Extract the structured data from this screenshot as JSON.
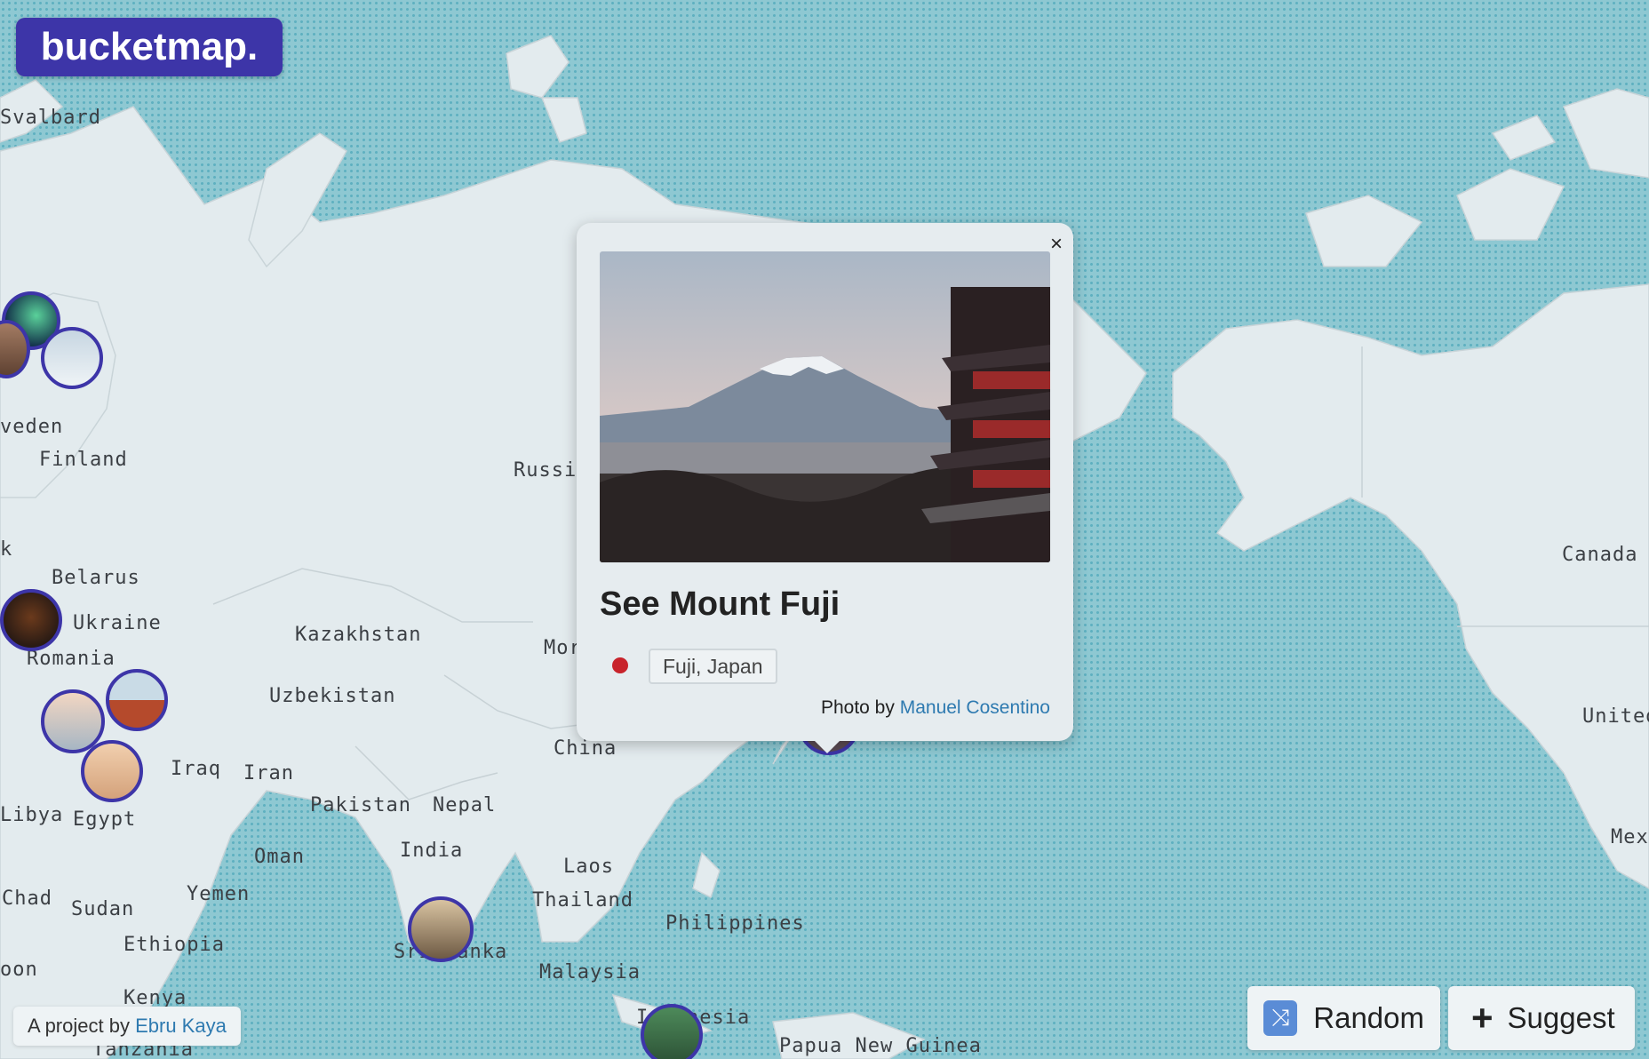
{
  "app": {
    "logo": "bucketmap."
  },
  "map": {
    "countries": [
      {
        "name": "Svalbard"
      },
      {
        "name": "veden"
      },
      {
        "name": "Finland"
      },
      {
        "name": "Russia"
      },
      {
        "name": "Belarus"
      },
      {
        "name": "Ukraine"
      },
      {
        "name": "Romania"
      },
      {
        "name": "Kazakhstan"
      },
      {
        "name": "Uzbekistan"
      },
      {
        "name": "Mor"
      },
      {
        "name": "Iraq"
      },
      {
        "name": "Iran"
      },
      {
        "name": "Libya"
      },
      {
        "name": "Egypt"
      },
      {
        "name": "Pakistan"
      },
      {
        "name": "Nepal"
      },
      {
        "name": "China"
      },
      {
        "name": "India"
      },
      {
        "name": "Oman"
      },
      {
        "name": "Chad"
      },
      {
        "name": "Sudan"
      },
      {
        "name": "Yemen"
      },
      {
        "name": "Laos"
      },
      {
        "name": "Thailand"
      },
      {
        "name": "Philippines"
      },
      {
        "name": "Ethiopia"
      },
      {
        "name": "Malaysia"
      },
      {
        "name": "Sri Lanka"
      },
      {
        "name": "Kenya"
      },
      {
        "name": "Indonesia"
      },
      {
        "name": "Papua New Guinea"
      },
      {
        "name": "Canada"
      },
      {
        "name": "United"
      },
      {
        "name": "Mexico"
      },
      {
        "name": "Tanzania"
      },
      {
        "name": "oon"
      },
      {
        "name": "k"
      }
    ]
  },
  "popup": {
    "title": "See Mount Fuji",
    "location": "Fuji, Japan",
    "credit_prefix": "Photo by",
    "credit_author": "Manuel Cosentino",
    "close_symbol": "×",
    "status_color": "#c8232b"
  },
  "footer": {
    "prefix": "A project by",
    "author": "Ebru Kaya"
  },
  "actions": {
    "random_label": "Random",
    "suggest_label": "Suggest"
  },
  "colors": {
    "brand": "#3d35a8",
    "link": "#2e7ab0"
  }
}
